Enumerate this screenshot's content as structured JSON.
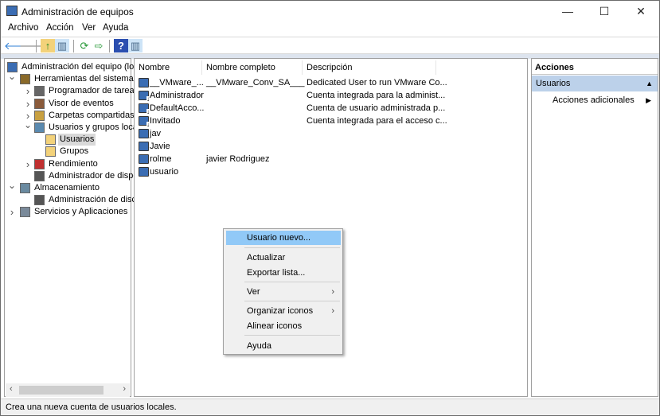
{
  "window": {
    "title": "Administración de equipos",
    "minimize": "—",
    "maximize": "☐",
    "close": "✕"
  },
  "menubar": [
    "Archivo",
    "Acción",
    "Ver",
    "Ayuda"
  ],
  "toolbar": {
    "back": "🡐",
    "forward": "🡒",
    "up": "↑",
    "show_hide_tree": "▥",
    "refresh": "⟳",
    "export": "⇨",
    "help": "?",
    "show_hide_action": "▥"
  },
  "tree": [
    {
      "label": "Administración del equipo (local)",
      "chevron": ""
    },
    {
      "label": "Herramientas del sistema",
      "chevron": "v"
    },
    {
      "label": "Programador de tareas",
      "chevron": ">"
    },
    {
      "label": "Visor de eventos",
      "chevron": ">"
    },
    {
      "label": "Carpetas compartidas",
      "chevron": ">"
    },
    {
      "label": "Usuarios y grupos locales",
      "chevron": "v"
    },
    {
      "label": "Usuarios",
      "chevron": ""
    },
    {
      "label": "Grupos",
      "chevron": ""
    },
    {
      "label": "Rendimiento",
      "chevron": ">"
    },
    {
      "label": "Administrador de dispositivos",
      "chevron": ""
    },
    {
      "label": "Almacenamiento",
      "chevron": "v"
    },
    {
      "label": "Administración de discos",
      "chevron": ""
    },
    {
      "label": "Servicios y Aplicaciones",
      "chevron": ">"
    }
  ],
  "list": {
    "columns": [
      "Nombre",
      "Nombre completo",
      "Descripción"
    ],
    "rows": [
      {
        "name": "__VMware_...",
        "full": "__VMware_Conv_SA___",
        "desc": "Dedicated User to run VMware Co...",
        "disabled": false
      },
      {
        "name": "Administrador",
        "full": "",
        "desc": "Cuenta integrada para la administ...",
        "disabled": true
      },
      {
        "name": "DefaultAcco...",
        "full": "",
        "desc": "Cuenta de usuario administrada p...",
        "disabled": true
      },
      {
        "name": "Invitado",
        "full": "",
        "desc": "Cuenta integrada para el acceso c...",
        "disabled": true
      },
      {
        "name": "jav",
        "full": "",
        "desc": "",
        "disabled": false
      },
      {
        "name": "Javie",
        "full": "",
        "desc": "",
        "disabled": false
      },
      {
        "name": "rolme",
        "full": "javier Rodriguez",
        "desc": "",
        "disabled": false
      },
      {
        "name": "usuario",
        "full": "",
        "desc": "",
        "disabled": false
      }
    ]
  },
  "actions": {
    "title": "Acciones",
    "section": "Usuarios",
    "more": "Acciones adicionales"
  },
  "context_menu": {
    "items": [
      "Usuario nuevo...",
      "Actualizar",
      "Exportar lista...",
      "Ver",
      "Organizar iconos",
      "Alinear iconos",
      "Ayuda"
    ],
    "highlighted": "Usuario nuevo..."
  },
  "status": "Crea una nueva cuenta de usuarios locales.",
  "colors": {
    "highlight": "#91c9f7",
    "actions_header": "#bcd1ea",
    "selection": "#d9d9d9"
  }
}
